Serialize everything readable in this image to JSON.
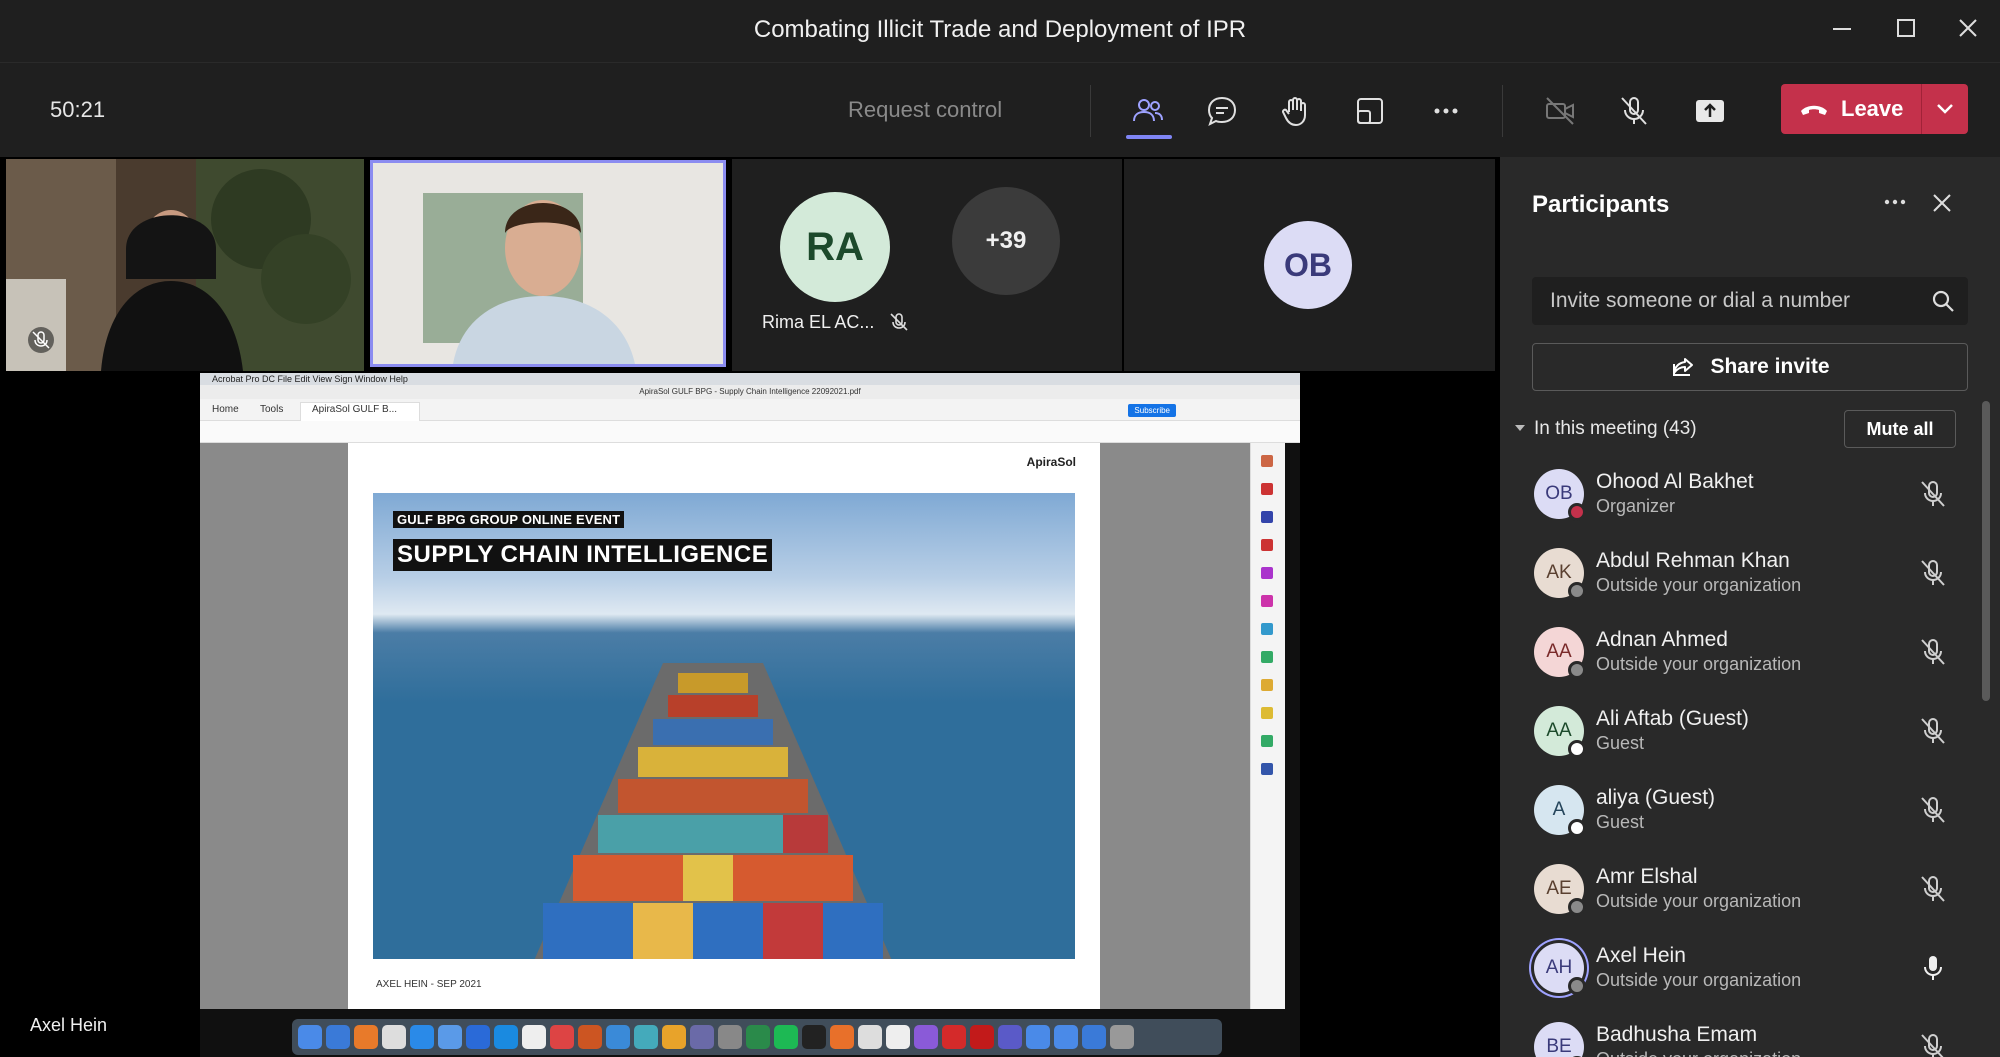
{
  "window": {
    "title": "Combating Illicit Trade and Deployment of IPR"
  },
  "toolbar": {
    "timer": "50:21",
    "request_control": "Request control",
    "leave_label": "Leave"
  },
  "stage": {
    "tiles": [
      {
        "name": "Rima EL AC...",
        "initials": "RA"
      },
      {
        "overflow": "+39"
      },
      {
        "initials": "OB"
      }
    ],
    "presenter_name": "Axel Hein"
  },
  "shared_screen": {
    "menubar": "Acrobat Pro DC   File   Edit   View   Sign   Window   Help",
    "window_title": "ApiraSol GULF BPG - Supply Chain Intelligence 22092021.pdf",
    "tabs": {
      "home": "Home",
      "tools": "Tools",
      "doc": "ApiraSol GULF B..."
    },
    "subscribe": "Subscribe",
    "page_logo": "ApiraSol",
    "slide_subtitle": "GULF BPG GROUP ONLINE EVENT",
    "slide_title": "SUPPLY CHAIN INTELLIGENCE",
    "slide_footer": "AXEL HEIN - SEP 2021"
  },
  "panel": {
    "title": "Participants",
    "invite_placeholder": "Invite someone or dial a number",
    "share_invite": "Share invite",
    "in_meeting": "In this meeting (43)",
    "mute_all": "Mute all",
    "participants": [
      {
        "initials": "OB",
        "name": "Ohood Al Bakhet",
        "role": "Organizer",
        "avatar_bg": "#dcdcf5",
        "avatar_fg": "#3a3a7a",
        "status_color": "#c4314b",
        "mic": "muted"
      },
      {
        "initials": "AK",
        "name": "Abdul Rehman Khan",
        "role": "Outside your organization",
        "avatar_bg": "#e8dcd2",
        "avatar_fg": "#5a4030",
        "status_color": "#8a8a8a",
        "mic": "muted"
      },
      {
        "initials": "AA",
        "name": "Adnan Ahmed",
        "role": "Outside your organization",
        "avatar_bg": "#f4d6d6",
        "avatar_fg": "#7a2a2a",
        "status_color": "#8a8a8a",
        "mic": "muted"
      },
      {
        "initials": "AA",
        "name": "Ali Aftab (Guest)",
        "role": "Guest",
        "avatar_bg": "#d3ead9",
        "avatar_fg": "#1c4a2b",
        "status_color": "#ffffff",
        "mic": "muted"
      },
      {
        "initials": "A",
        "name": "aliya (Guest)",
        "role": "Guest",
        "avatar_bg": "#d6e6f0",
        "avatar_fg": "#24445a",
        "status_color": "#ffffff",
        "mic": "muted"
      },
      {
        "initials": "AE",
        "name": "Amr Elshal",
        "role": "Outside your organization",
        "avatar_bg": "#e8dcd2",
        "avatar_fg": "#5a4030",
        "status_color": "#8a8a8a",
        "mic": "muted"
      },
      {
        "initials": "AH",
        "name": "Axel Hein",
        "role": "Outside your organization",
        "avatar_bg": "#dcdcf5",
        "avatar_fg": "#3a3a7a",
        "status_color": "#8a8a8a",
        "mic": "on"
      },
      {
        "initials": "BE",
        "name": "Badhusha Emam",
        "role": "Outside your organization",
        "avatar_bg": "#dcdcf5",
        "avatar_fg": "#3a3a7a",
        "status_color": "#8a8a8a",
        "mic": "muted"
      }
    ]
  }
}
